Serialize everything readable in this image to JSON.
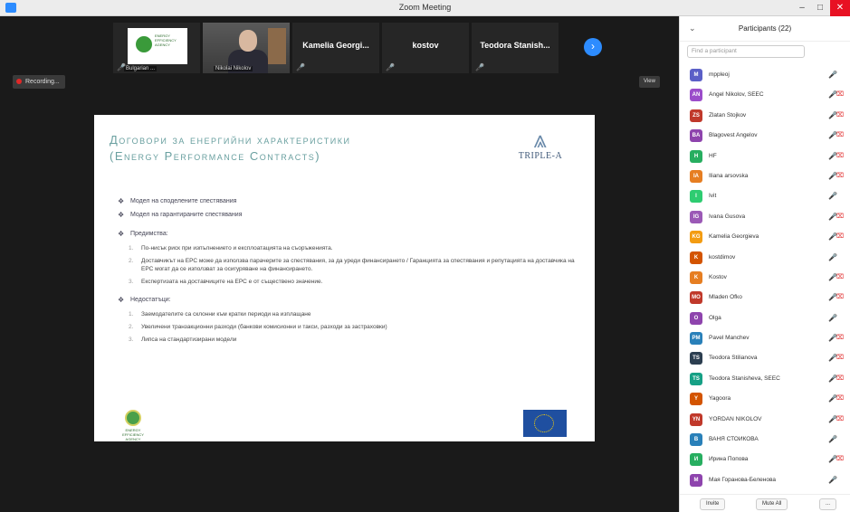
{
  "window": {
    "title": "Zoom Meeting",
    "minimize": "–",
    "maximize": "□",
    "close": "✕"
  },
  "thumbnails": [
    {
      "name": "",
      "caption": "Bulgarian ...",
      "type": "logo",
      "logo_text": "ENERGY EFFICIENCY AGENCY"
    },
    {
      "name": "",
      "caption": "Nikolai Nikolov",
      "type": "video"
    },
    {
      "name": "Kamelia Georgi...",
      "caption": "",
      "type": "name"
    },
    {
      "name": "kostov",
      "caption": "",
      "type": "name"
    },
    {
      "name": "Teodora Stanish...",
      "caption": "",
      "type": "name"
    }
  ],
  "next_icon": "›",
  "recording_label": "Recording...",
  "view_label": "View",
  "slide": {
    "title_line1": "Договори за енергийни характеристики",
    "title_line2": "(Energy Performance Contracts)",
    "brand_mark": "⩓",
    "brand_name": "TRIPLE-A",
    "bullets": [
      {
        "text": "Модел на споделените спестявания"
      },
      {
        "text": "Модел на гарантираните спестявания"
      },
      {
        "text": "Предимства:",
        "items": [
          "По-нисък риск при изпълнението и експлоатацията на съоръженията.",
          "Доставчикът на ЕРС може да използва парачерите за спестявания, за да уреди финансирането / Гаранцията за спестявания и репутацията на доставчика на ЕРС могат да се използват за осигуряване на финансирането.",
          "Експертизата на доставчиците на ЕРС е от съществено значение."
        ]
      },
      {
        "text": "Недостатъци:",
        "items": [
          "Заемодателите са склонни към кратки периоди на изплащане",
          "Увеличени транзакционни разходи (банкови комисионни и такси, разходи за застраховки)",
          "Липса на стандартизирани модели"
        ]
      }
    ],
    "left_logo_text": "ENERGY EFFICIENCY AGENCY"
  },
  "panel": {
    "collapse": "⌄",
    "title": "Participants (22)",
    "search_placeholder": "Find a participant",
    "participants": [
      {
        "initials": "M",
        "name": "mppleoj",
        "color": "#5b5fc7",
        "mic": "🎤",
        "cam": "",
        "muted": false
      },
      {
        "initials": "AN",
        "name": "Angel Nikolov, SEEC",
        "color": "#9b4dca",
        "mic": "🎤",
        "cam": "⌧",
        "muted": true
      },
      {
        "initials": "ZS",
        "name": "Zlatan Stojkov",
        "color": "#c0392b",
        "mic": "🎤",
        "cam": "⌧",
        "muted": true
      },
      {
        "initials": "BA",
        "name": "Blagovest Angelov",
        "color": "#8e44ad",
        "mic": "🎤",
        "cam": "⌧",
        "muted": true
      },
      {
        "initials": "H",
        "name": "HF",
        "color": "#27ae60",
        "mic": "🎤",
        "cam": "⌧",
        "muted": true
      },
      {
        "initials": "IA",
        "name": "Iliana arsovska",
        "color": "#e67e22",
        "mic": "🎤",
        "cam": "⌧",
        "muted": true
      },
      {
        "initials": "I",
        "name": "Ivit",
        "color": "#2ecc71",
        "mic": "🎤",
        "cam": "",
        "muted": true
      },
      {
        "initials": "IG",
        "name": "Ivana Gusova",
        "color": "#9b59b6",
        "mic": "🎤",
        "cam": "⌧",
        "muted": true
      },
      {
        "initials": "KG",
        "name": "Kamelia Georgieva",
        "color": "#f39c12",
        "mic": "🎤",
        "cam": "⌧",
        "muted": true
      },
      {
        "initials": "K",
        "name": "kostdimov",
        "color": "#d35400",
        "mic": "🎤",
        "cam": "",
        "muted": true
      },
      {
        "initials": "K",
        "name": "Kostov",
        "color": "#e67e22",
        "mic": "🎤",
        "cam": "⌧",
        "muted": true
      },
      {
        "initials": "MO",
        "name": "Mladen Ofko",
        "color": "#c0392b",
        "mic": "🎤",
        "cam": "⌧",
        "muted": true
      },
      {
        "initials": "O",
        "name": "Olga",
        "color": "#8e44ad",
        "mic": "🎤",
        "cam": "",
        "muted": true
      },
      {
        "initials": "PM",
        "name": "Pavel Manchev",
        "color": "#2980b9",
        "mic": "🎤",
        "cam": "⌧",
        "muted": true
      },
      {
        "initials": "TS",
        "name": "Teodora Stilianova",
        "color": "#2c3e50",
        "mic": "🎤",
        "cam": "⌧",
        "muted": true
      },
      {
        "initials": "TS",
        "name": "Teodora Stanisheva, SEEC",
        "color": "#16a085",
        "mic": "🎤",
        "cam": "⌧",
        "muted": true
      },
      {
        "initials": "Y",
        "name": "Yagoora",
        "color": "#d35400",
        "mic": "🎤",
        "cam": "⌧",
        "muted": true
      },
      {
        "initials": "YN",
        "name": "YORDAN NIKOLOV",
        "color": "#c0392b",
        "mic": "🎤",
        "cam": "⌧",
        "muted": true
      },
      {
        "initials": "B",
        "name": "ВАНЯ СТОЙКОВА",
        "color": "#2980b9",
        "mic": "🎤",
        "cam": "",
        "muted": true
      },
      {
        "initials": "И",
        "name": "Ирина Попова",
        "color": "#27ae60",
        "mic": "🎤",
        "cam": "⌧",
        "muted": true
      },
      {
        "initials": "M",
        "name": "Мая Горанова-Беленова",
        "color": "#8e44ad",
        "mic": "🎤",
        "cam": "",
        "muted": true
      }
    ],
    "invite_label": "Invite",
    "mute_all_label": "Mute All",
    "more_label": "..."
  }
}
